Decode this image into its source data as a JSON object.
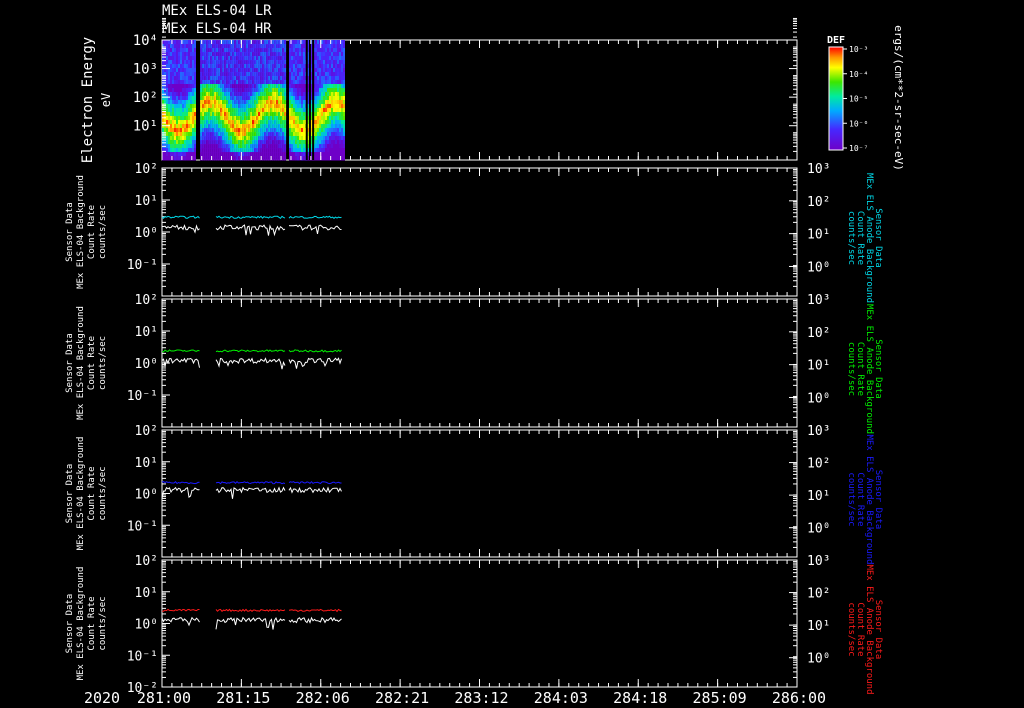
{
  "titles": [
    "MEx ELS-04 LR",
    "MEx ELS-04 HR"
  ],
  "colorbar": {
    "label": "DEF",
    "unit": "ergs/(cm**2-sr-sec-eV)",
    "ticks": [
      "10⁻³",
      "10⁻⁴",
      "10⁻⁵",
      "10⁻⁶",
      "10⁻⁷"
    ]
  },
  "time_axis": {
    "year": "2020",
    "ticks": [
      "281:00",
      "281:15",
      "282:06",
      "282:21",
      "283:12",
      "284:03",
      "284:18",
      "285:09",
      "286:00"
    ]
  },
  "spectrogram": {
    "ylabel": "Electron Energy",
    "yunit": "eV",
    "ytick_labels": [
      "10⁴",
      "10³",
      "10²",
      "10¹"
    ],
    "data_spans": [
      [
        0.0,
        0.051
      ],
      [
        0.06,
        0.193
      ],
      [
        0.2,
        0.286
      ]
    ]
  },
  "chart_data": [
    {
      "type": "heatmap",
      "title": "MEx ELS-04 LR / MEx ELS-04 HR",
      "ylabel": "Electron Energy eV",
      "yscale": "log",
      "ylim": [
        1,
        10000
      ],
      "colorbar": {
        "label": "DEF",
        "unit": "ergs/(cm**2-sr-sec-eV)",
        "range": [
          1e-07,
          0.001
        ]
      },
      "x_range": [
        "281:00",
        "286:00"
      ]
    },
    {
      "type": "line",
      "left_axis_label": [
        "Sensor Data",
        "MEx ELS-04 Background",
        "Count Rate",
        "counts/sec"
      ],
      "right_axis_label": [
        "Sensor Data",
        "MEx ELS Anode Background",
        "Count Rate",
        "counts/sec"
      ],
      "left_ticks": [
        "10²",
        "10¹",
        "10⁰",
        "10⁻¹"
      ],
      "right_ticks": [
        "10³",
        "10²",
        "10¹",
        "10⁰"
      ],
      "yscale": "log",
      "ylim": [
        0.01,
        100
      ],
      "series": [
        {
          "color": "#00d8e8",
          "level": 2.9
        },
        {
          "color": "#ffffff",
          "level": 1.4
        }
      ]
    },
    {
      "type": "line",
      "left_axis_label": [
        "Sensor Data",
        "MEx ELS-04 Background",
        "Count Rate",
        "counts/sec"
      ],
      "right_axis_label": [
        "Sensor Data",
        "MEx ELS Anode Background",
        "Count Rate",
        "counts/sec"
      ],
      "left_ticks": [
        "10²",
        "10¹",
        "10⁰",
        "10⁻¹"
      ],
      "right_ticks": [
        "10³",
        "10²",
        "10¹",
        "10⁰"
      ],
      "yscale": "log",
      "ylim": [
        0.01,
        100
      ],
      "series": [
        {
          "color": "#00ee00",
          "level": 2.4
        },
        {
          "color": "#ffffff",
          "level": 1.2
        }
      ]
    },
    {
      "type": "line",
      "left_axis_label": [
        "Sensor Data",
        "MEx ELS-04 Background",
        "Count Rate",
        "counts/sec"
      ],
      "right_axis_label": [
        "Sensor Data",
        "MEx ELS Anode Background",
        "Count Rate",
        "counts/sec"
      ],
      "left_ticks": [
        "10²",
        "10¹",
        "10⁰",
        "10⁻¹"
      ],
      "right_ticks": [
        "10³",
        "10²",
        "10¹",
        "10⁰"
      ],
      "yscale": "log",
      "ylim": [
        0.01,
        100
      ],
      "series": [
        {
          "color": "#1a1aff",
          "level": 2.2
        },
        {
          "color": "#ffffff",
          "level": 1.3
        }
      ]
    },
    {
      "type": "line",
      "left_axis_label": [
        "Sensor Data",
        "MEx ELS-04 Background",
        "Count Rate",
        "counts/sec"
      ],
      "right_axis_label": [
        "Sensor Data",
        "MEx ELS Anode Background",
        "Count Rate",
        "counts/sec"
      ],
      "left_ticks": [
        "10²",
        "10¹",
        "10⁰",
        "10⁻¹",
        "10⁻²"
      ],
      "right_ticks": [
        "10³",
        "10²",
        "10¹",
        "10⁰"
      ],
      "yscale": "log",
      "ylim": [
        0.01,
        100
      ],
      "series": [
        {
          "color": "#ff1a1a",
          "level": 2.6
        },
        {
          "color": "#ffffff",
          "level": 1.3
        }
      ]
    }
  ]
}
